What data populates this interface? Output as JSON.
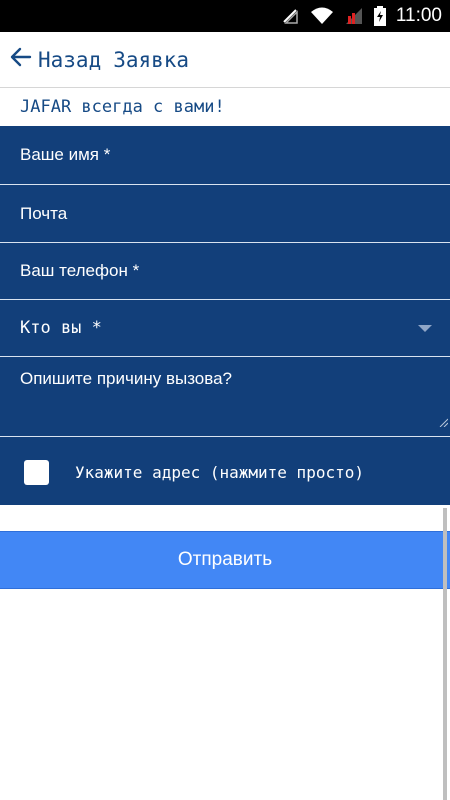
{
  "status_bar": {
    "time": "11:00",
    "icons": [
      "signal-off-icon",
      "wifi-icon",
      "mobile-signal-icon",
      "battery-icon"
    ]
  },
  "app_bar": {
    "back_label": "Назад",
    "title": "Заявка"
  },
  "slogan": "JAFAR всегда с вами!",
  "form": {
    "name_placeholder": "Ваше имя *",
    "email_placeholder": "Почта",
    "phone_placeholder": "Ваш телефон *",
    "who_placeholder": "Кто вы *",
    "reason_placeholder": "Опишите причину вызова?",
    "address_label": "Укажите адрес (нажмите просто)",
    "address_checked": false
  },
  "submit_label": "Отправить",
  "colors": {
    "primary": "#164a85",
    "form_bg": "#123f7a",
    "button": "#4287f5"
  }
}
